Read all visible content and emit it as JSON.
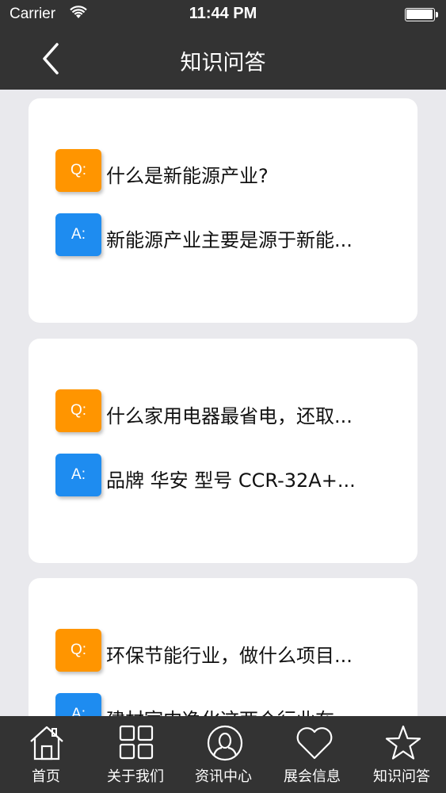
{
  "status": {
    "carrier": "Carrier",
    "time": "11:44 PM"
  },
  "nav": {
    "title": "知识问答"
  },
  "qa_items": [
    {
      "q_badge": "Q:",
      "a_badge": "A:",
      "question": "什么是新能源产业?",
      "answer": "新能源产业主要是源于新能..."
    },
    {
      "q_badge": "Q:",
      "a_badge": "A:",
      "question": "什么家用电器最省电，还取...",
      "answer": "品牌 华安 型号 CCR-32A+..."
    },
    {
      "q_badge": "Q:",
      "a_badge": "A:",
      "question": "环保节能行业，做什么项目...",
      "answer": "建材室内净化这两个行业在..."
    }
  ],
  "tabs": [
    {
      "label": "首页",
      "icon": "home-icon"
    },
    {
      "label": "关于我们",
      "icon": "grid-icon"
    },
    {
      "label": "资讯中心",
      "icon": "person-circle-icon"
    },
    {
      "label": "展会信息",
      "icon": "heart-icon"
    },
    {
      "label": "知识问答",
      "icon": "star-icon"
    }
  ],
  "colors": {
    "bar_bg": "#333333",
    "question_badge": "#ff9500",
    "answer_badge": "#1e8cf0",
    "page_bg": "#e9e9ed"
  }
}
